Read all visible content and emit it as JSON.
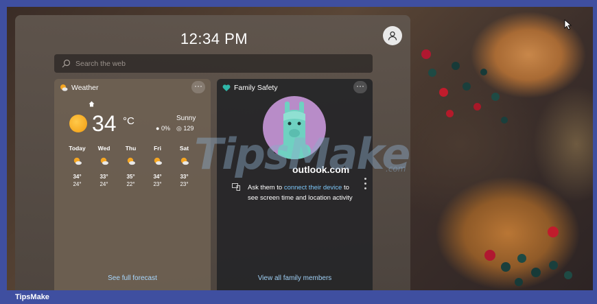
{
  "header": {
    "time": "12:34 PM",
    "avatar_icon": "person-icon"
  },
  "search": {
    "placeholder": "Search the web"
  },
  "weather": {
    "title": "Weather",
    "location_icon": "home-icon",
    "temperature": "34",
    "unit": "°C",
    "condition": "Sunny",
    "precipitation": "0%",
    "aqi": "129",
    "forecast": [
      {
        "day": "Today",
        "high": "34°",
        "low": "24°",
        "icon": "partly-sunny-icon"
      },
      {
        "day": "Wed",
        "high": "33°",
        "low": "24°",
        "icon": "partly-sunny-icon"
      },
      {
        "day": "Thu",
        "high": "35°",
        "low": "22°",
        "icon": "partly-sunny-icon"
      },
      {
        "day": "Fri",
        "high": "34°",
        "low": "23°",
        "icon": "partly-sunny-icon"
      },
      {
        "day": "Sat",
        "high": "33°",
        "low": "23°",
        "icon": "partly-sunny-icon"
      }
    ],
    "link": "See full forecast",
    "more": "···"
  },
  "family": {
    "title": "Family Safety",
    "account": "outlook.com",
    "message_pre": "Ask them to ",
    "message_link": "connect their device",
    "message_post": " to see screen time and location activity",
    "link": "View all family members",
    "more": "···"
  },
  "watermark": {
    "brand": "TipsMake",
    "domain": ".com"
  },
  "footer": {
    "label": "TipsMake"
  },
  "colors": {
    "frame": "#3f4fa0",
    "accent_link": "#7cc6f7",
    "sun": "#f29c10"
  }
}
